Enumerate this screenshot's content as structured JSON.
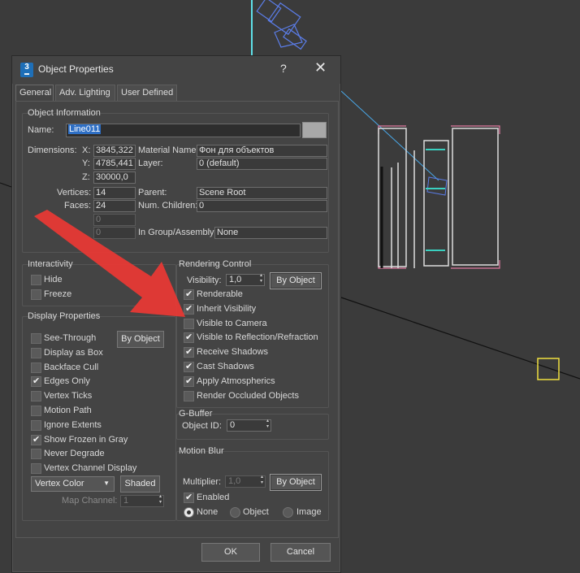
{
  "dialog": {
    "title": "Object Properties",
    "help": "?",
    "close": "✕",
    "tabs": [
      "General",
      "Adv. Lighting",
      "User Defined"
    ],
    "active_tab": "General"
  },
  "object_info": {
    "title": "Object Information",
    "name_label": "Name:",
    "name_value": "Line011",
    "dimensions_label": "Dimensions:",
    "x_label": "X:",
    "x_value": "3845,322",
    "y_label": "Y:",
    "y_value": "4785,441",
    "z_label": "Z:",
    "z_value": "30000,0",
    "material_label": "Material Name:",
    "material_value": "Фон для объектов",
    "layer_label": "Layer:",
    "layer_value": "0 (default)",
    "vertices_label": "Vertices:",
    "vertices_value": "14",
    "faces_label": "Faces:",
    "faces_value": "24",
    "parent_label": "Parent:",
    "parent_value": "Scene Root",
    "children_label": "Num. Children:",
    "children_value": "0",
    "extra1_value": "0",
    "extra2_value": "0",
    "group_label": "In Group/Assembly:",
    "group_value": "None"
  },
  "interactivity": {
    "title": "Interactivity",
    "hide": "Hide",
    "freeze": "Freeze"
  },
  "display_properties": {
    "title": "Display Properties",
    "by_object": "By Object",
    "items": [
      {
        "label": "See-Through",
        "checked": false
      },
      {
        "label": "Display as Box",
        "checked": false
      },
      {
        "label": "Backface Cull",
        "checked": false
      },
      {
        "label": "Edges Only",
        "checked": true
      },
      {
        "label": "Vertex Ticks",
        "checked": false
      },
      {
        "label": "Motion Path",
        "checked": false
      },
      {
        "label": "Ignore Extents",
        "checked": false
      },
      {
        "label": "Show Frozen in Gray",
        "checked": true
      },
      {
        "label": "Never Degrade",
        "checked": false
      },
      {
        "label": "Vertex Channel Display",
        "checked": false
      }
    ],
    "vertex_color": "Vertex Color",
    "shaded": "Shaded",
    "map_channel_label": "Map Channel:",
    "map_channel_value": "1"
  },
  "rendering_control": {
    "title": "Rendering Control",
    "visibility_label": "Visibility:",
    "visibility_value": "1,0",
    "by_object": "By Object",
    "items": [
      {
        "label": "Renderable",
        "checked": true
      },
      {
        "label": "Inherit Visibility",
        "checked": true
      },
      {
        "label": "Visible to Camera",
        "checked": false
      },
      {
        "label": "Visible to Reflection/Refraction",
        "checked": true
      },
      {
        "label": "Receive Shadows",
        "checked": true
      },
      {
        "label": "Cast Shadows",
        "checked": true
      },
      {
        "label": "Apply Atmospherics",
        "checked": true
      },
      {
        "label": "Render Occluded Objects",
        "checked": false
      }
    ]
  },
  "gbuffer": {
    "title": "G-Buffer",
    "object_id_label": "Object ID:",
    "object_id_value": "0"
  },
  "motion_blur": {
    "title": "Motion Blur",
    "multiplier_label": "Multiplier:",
    "multiplier_value": "1,0",
    "by_object": "By Object",
    "enabled": "Enabled",
    "radios": [
      "None",
      "Object",
      "Image"
    ],
    "selected": "None"
  },
  "footer": {
    "ok": "OK",
    "cancel": "Cancel"
  },
  "colors": {
    "accent_selection": "#2e6fc5",
    "annotation_arrow": "#e53935",
    "viewport_bg": "#3b3b3b",
    "dialog_bg": "#444444"
  }
}
